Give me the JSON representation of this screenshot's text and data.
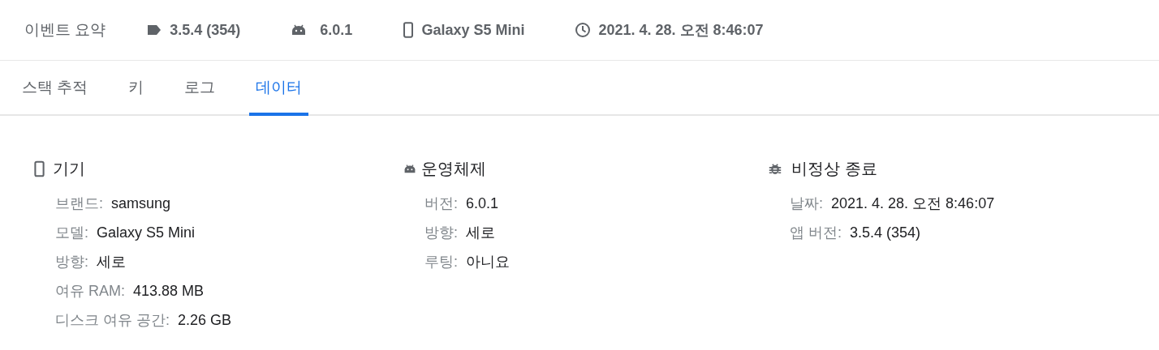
{
  "summary": {
    "title": "이벤트 요약",
    "items": [
      {
        "kind": "tag",
        "text": "3.5.4 (354)"
      },
      {
        "kind": "android",
        "text": "6.0.1"
      },
      {
        "kind": "phone",
        "text": "Galaxy S5 Mini"
      },
      {
        "kind": "clock",
        "text": "2021. 4. 28. 오전 8:46:07"
      }
    ]
  },
  "tabs": [
    {
      "label": "스택 추적",
      "selected": false
    },
    {
      "label": "키",
      "selected": false
    },
    {
      "label": "로그",
      "selected": false
    },
    {
      "label": "데이터",
      "selected": true
    }
  ],
  "sections": [
    {
      "kind": "phone",
      "title": "기기",
      "rows": [
        {
          "label": "브랜드:",
          "value": "samsung"
        },
        {
          "label": "모델:",
          "value": "Galaxy S5 Mini"
        },
        {
          "label": "방향:",
          "value": "세로"
        },
        {
          "label": "여유 RAM:",
          "value": "413.88 MB"
        },
        {
          "label": "디스크 여유 공간:",
          "value": "2.26 GB"
        }
      ]
    },
    {
      "kind": "android",
      "title": "운영체제",
      "rows": [
        {
          "label": "버전:",
          "value": "6.0.1"
        },
        {
          "label": "방향:",
          "value": "세로"
        },
        {
          "label": "루팅:",
          "value": "아니요"
        }
      ]
    },
    {
      "kind": "bug",
      "title": "비정상 종료",
      "rows": [
        {
          "label": "날짜:",
          "value": "2021. 4. 28. 오전 8:46:07"
        },
        {
          "label": "앱 버전:",
          "value": "3.5.4 (354)"
        }
      ]
    }
  ]
}
